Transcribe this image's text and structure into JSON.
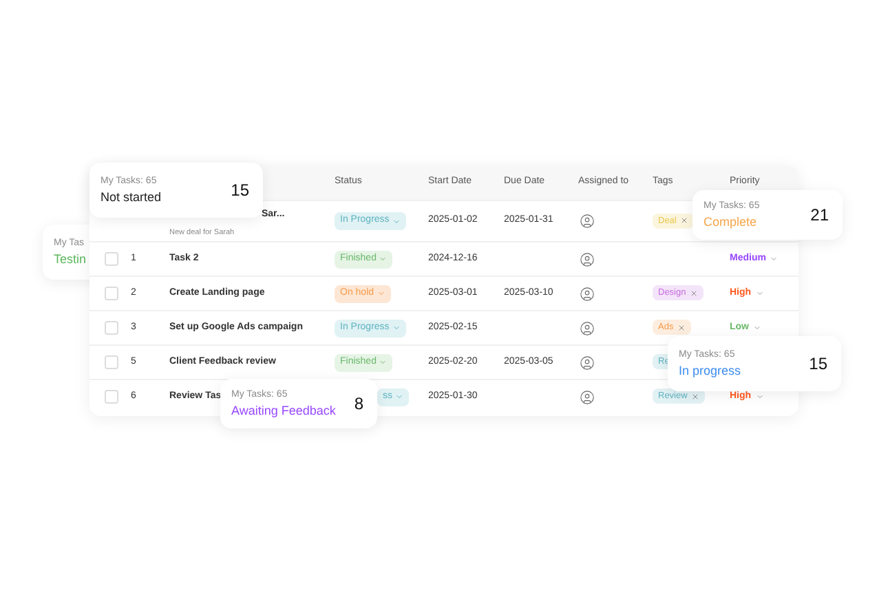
{
  "table": {
    "columns": [
      "Status",
      "Start Date",
      "Due Date",
      "Assigned to",
      "Tags",
      "Priority"
    ],
    "rows": [
      {
        "name": "Sar...",
        "subtitle": "New deal for Sarah",
        "status": {
          "label": "In Progress",
          "kind": "in_progress"
        },
        "start": "2025-01-02",
        "due": "2025-01-31",
        "tag": {
          "label": "Deal",
          "color": "#e8c84a",
          "removable": true
        }
      },
      {
        "number": "1",
        "checked": false,
        "name": "Task 2",
        "status": {
          "label": "Finished",
          "kind": "finished"
        },
        "start": "2024-12-16",
        "priority": {
          "label": "Medium",
          "kind": "medium"
        }
      },
      {
        "number": "2",
        "checked": false,
        "name": "Create Landing page",
        "status": {
          "label": "On hold",
          "kind": "on_hold"
        },
        "start": "2025-03-01",
        "due": "2025-03-10",
        "tag": {
          "label": "Design",
          "color": "#c46ce0",
          "removable": true
        },
        "priority": {
          "label": "High",
          "kind": "high"
        }
      },
      {
        "number": "3",
        "checked": false,
        "name": "Set up Google Ads campaign",
        "status": {
          "label": "In Progress",
          "kind": "in_progress"
        },
        "start": "2025-02-15",
        "tag": {
          "label": "Ads",
          "color": "#f59a4a",
          "removable": true
        },
        "priority": {
          "label": "Low",
          "kind": "low"
        }
      },
      {
        "number": "5",
        "checked": false,
        "name": "Client Feedback review",
        "status": {
          "label": "Finished",
          "kind": "finished"
        },
        "start": "2025-02-20",
        "due": "2025-03-05",
        "tag": {
          "label": "Re",
          "color": "#5fb3c0",
          "removable": false
        }
      },
      {
        "number": "6",
        "checked": false,
        "name": "Review Tas",
        "status": {
          "label": "ss",
          "kind": "in_progress"
        },
        "start": "2025-01-30",
        "tag": {
          "label": "Review",
          "color": "#5fb3c0",
          "removable": true
        },
        "priority": {
          "label": "High",
          "kind": "high"
        }
      }
    ]
  },
  "cards": [
    {
      "title": "My Tas",
      "label": "Testin",
      "color": "#5cb85c",
      "behind": true
    },
    {
      "title": "My Tasks: 65",
      "label": "Not started",
      "count": "15",
      "color": "#222222",
      "behind": false
    },
    {
      "title": "My Tasks: 65",
      "label": "Complete",
      "count": "21",
      "color": "#f5a54a",
      "behind": false
    },
    {
      "title": "My Tasks: 65",
      "label": "In progress",
      "count": "15",
      "color": "#3b8cf0",
      "behind": false
    },
    {
      "title": "My Tasks: 65",
      "label": "Awaiting Feedback",
      "count": "8",
      "color": "#9747ff",
      "behind": false
    }
  ]
}
